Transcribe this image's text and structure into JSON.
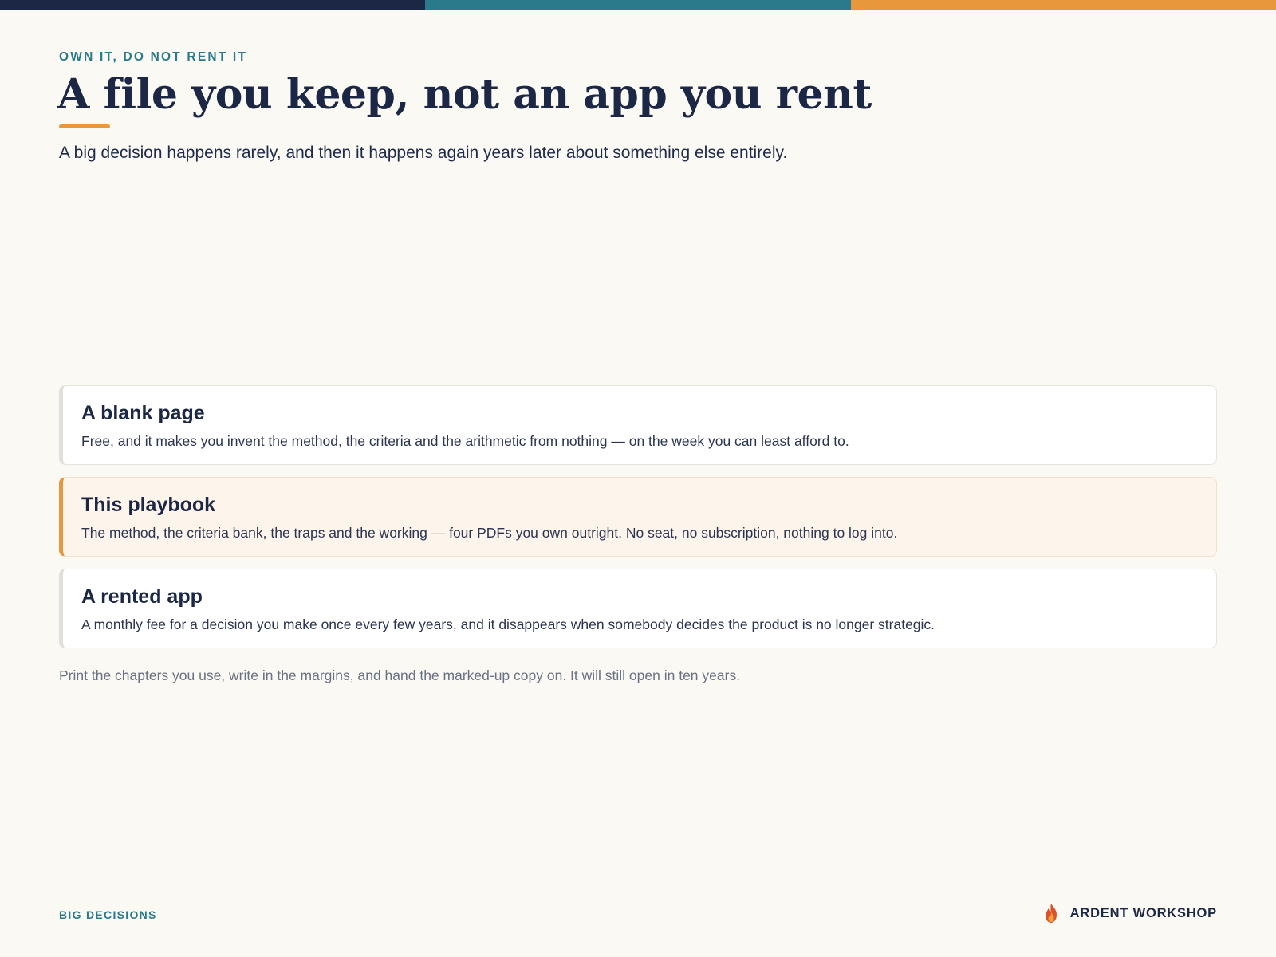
{
  "colors": {
    "navy": "#1c2746",
    "teal": "#2b7a8c",
    "orange": "#e8973c",
    "background": "#faf9f4"
  },
  "eyebrow": "OWN IT, DO NOT RENT IT",
  "title": "A file you keep, not an app you rent",
  "lede": "A big decision happens rarely, and then it happens again years later about something else entirely.",
  "options": [
    {
      "title": "A blank page",
      "description": "Free, and it makes you invent the method, the criteria and the arithmetic from nothing — on the week you can least afford to.",
      "highlighted": false
    },
    {
      "title": "This playbook",
      "description": "The method, the criteria bank, the traps and the working — four PDFs you own outright. No seat, no subscription, nothing to log into.",
      "highlighted": true
    },
    {
      "title": "A rented app",
      "description": "A monthly fee for a decision you make once every few years, and it disappears when somebody decides the product is no longer strategic.",
      "highlighted": false
    }
  ],
  "note": "Print the chapters you use, write in the margins, and hand the marked-up copy on. It will still open in ten years.",
  "footer": {
    "section_label": "BIG DECISIONS",
    "brand": "ARDENT WORKSHOP",
    "brand_icon": "flame-icon"
  }
}
